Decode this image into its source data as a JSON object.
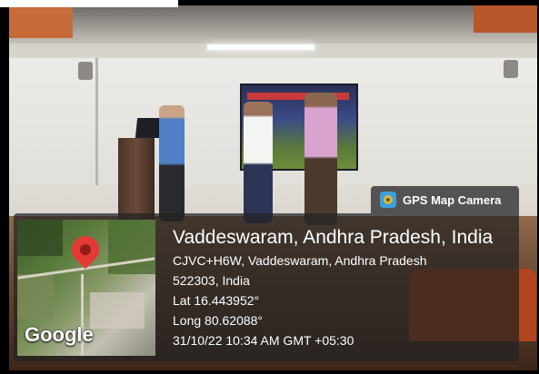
{
  "overlay": {
    "badge_icon": "gps-map-camera-app-icon",
    "badge_label": "GPS Map Camera",
    "map_logo": "Google",
    "title": "Vaddeswaram, Andhra Pradesh, India",
    "address_line1": "CJVC+H6W, Vaddeswaram, Andhra Pradesh",
    "address_line2": "522303, India",
    "latitude": "Lat 16.443952°",
    "longitude": "Long 80.62088°",
    "timestamp": "31/10/22 10:34 AM GMT +05:30"
  },
  "colors": {
    "overlay_background": "#232323",
    "pin": "#e53935",
    "text": "#ffffff"
  }
}
